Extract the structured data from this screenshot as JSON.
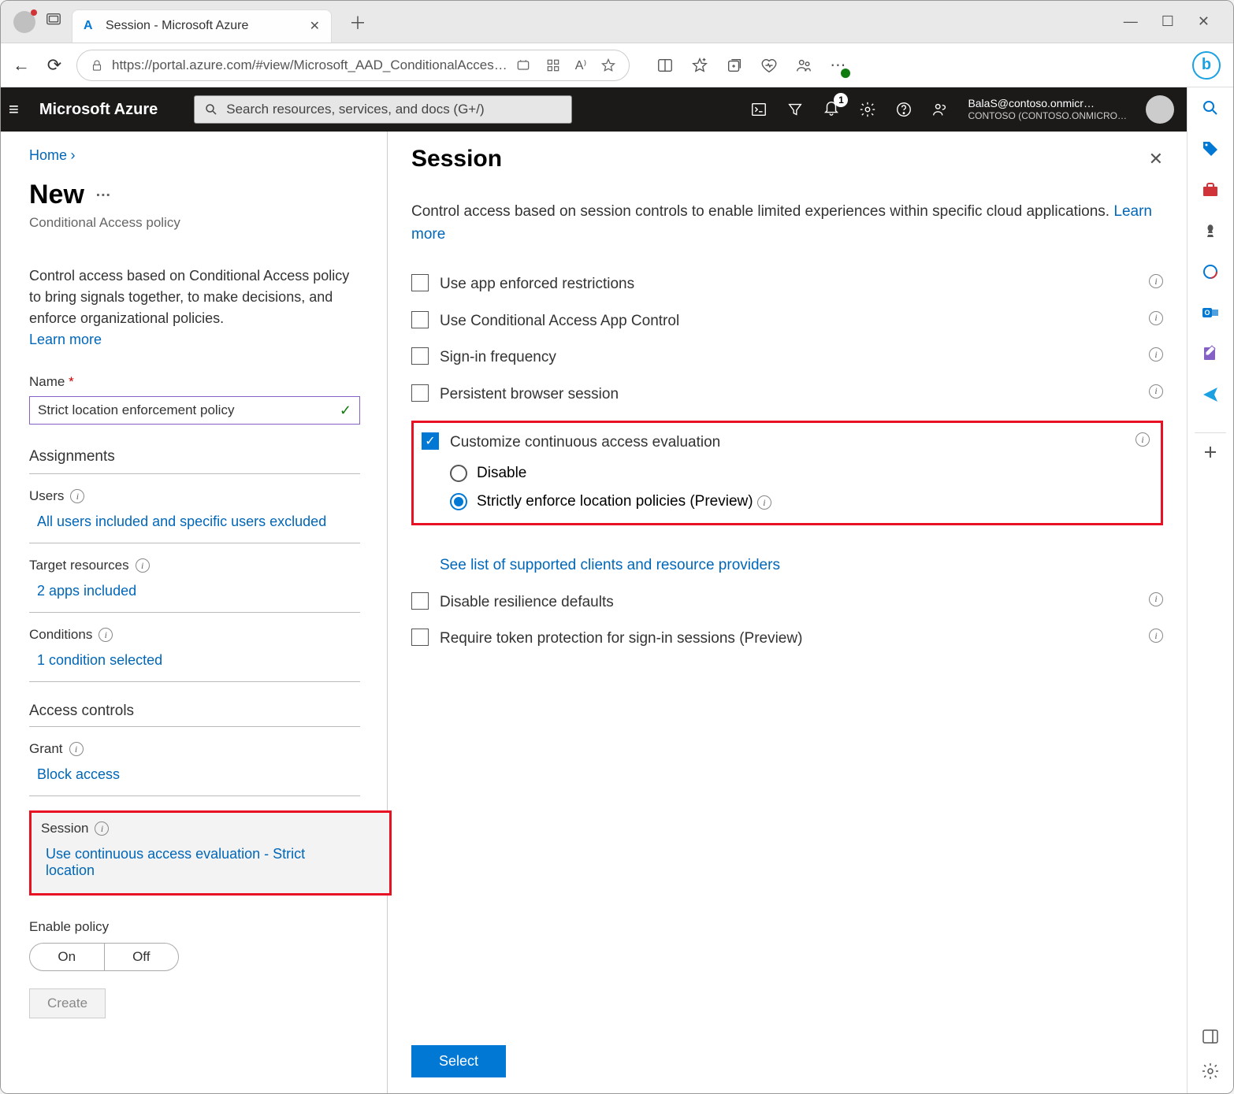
{
  "browser": {
    "tab_title": "Session - Microsoft Azure",
    "url": "https://portal.azure.com/#view/Microsoft_AAD_ConditionalAcces…"
  },
  "az_header": {
    "brand": "Microsoft Azure",
    "search_placeholder": "Search resources, services, and docs (G+/)",
    "notif_count": "1",
    "user": "BalaS@contoso.onmicr…",
    "tenant": "CONTOSO (CONTOSO.ONMICRO…"
  },
  "left": {
    "crumb_home": "Home",
    "title": "New",
    "subtitle": "Conditional Access policy",
    "desc": "Control access based on Conditional Access policy to bring signals together, to make decisions, and enforce organizational policies.",
    "learn": "Learn more",
    "name_label": "Name",
    "name_value": "Strict location enforcement policy",
    "assignments_hd": "Assignments",
    "users_label": "Users",
    "users_value": "All users included and specific users excluded",
    "target_label": "Target resources",
    "target_value": "2 apps included",
    "conditions_label": "Conditions",
    "conditions_value": "1 condition selected",
    "access_hd": "Access controls",
    "grant_label": "Grant",
    "grant_value": "Block access",
    "session_label": "Session",
    "session_value": "Use continuous access evaluation - Strict location",
    "enable_label": "Enable policy",
    "seg_on": "On",
    "seg_off": "Off",
    "create": "Create"
  },
  "right": {
    "title": "Session",
    "desc_prefix": "Control access based on session controls to enable limited experiences within specific cloud applications. ",
    "learn": "Learn more",
    "opt1": "Use app enforced restrictions",
    "opt2": "Use Conditional Access App Control",
    "opt3": "Sign-in frequency",
    "opt4": "Persistent browser session",
    "opt5": "Customize continuous access evaluation",
    "radio1": "Disable",
    "radio2": "Strictly enforce location policies (Preview)",
    "link": "See list of supported clients and resource providers",
    "opt6": "Disable resilience defaults",
    "opt7": "Require token protection for sign-in sessions (Preview)",
    "select": "Select"
  }
}
